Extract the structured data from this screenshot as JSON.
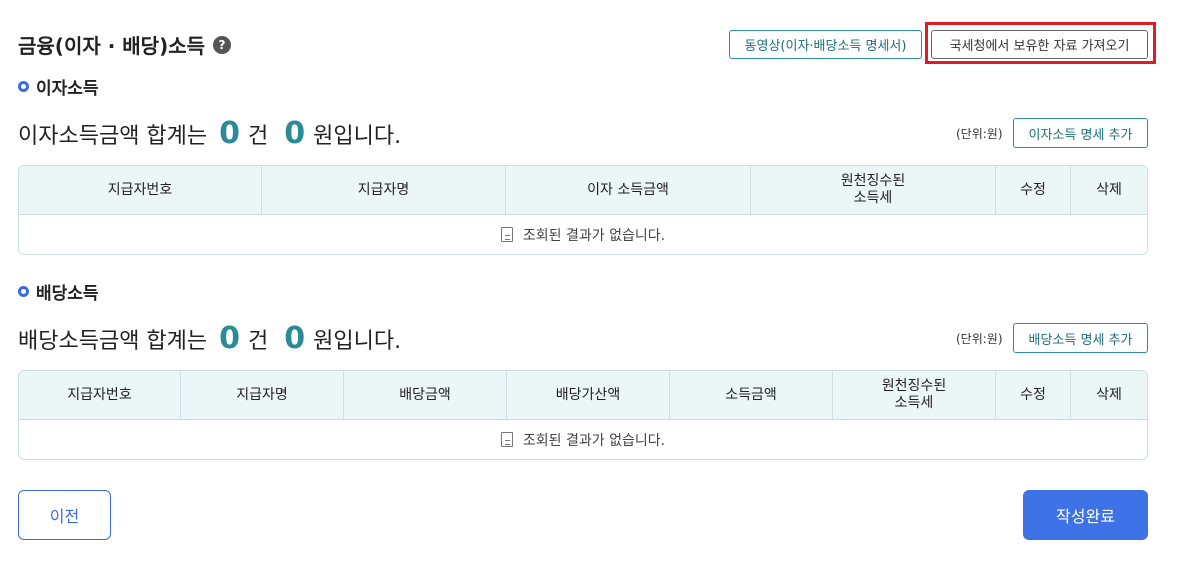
{
  "header": {
    "title": "금융(이자 · 배당)소득",
    "help_icon": "?",
    "video_button": "동영상(이자·배당소득 명세서)",
    "import_button": "국세청에서 보유한 자료 가져오기"
  },
  "interest": {
    "section_label": "이자소득",
    "summary_prefix": "이자소득금액 합계는",
    "count": "0",
    "count_unit": "건",
    "amount": "0",
    "amount_suffix": "원입니다.",
    "unit_note": "(단위:원)",
    "add_button": "이자소득 명세 추가",
    "columns": [
      "지급자번호",
      "지급자명",
      "이자 소득금액",
      "원천징수된\n소득세",
      "수정",
      "삭제"
    ],
    "empty_text": "조회된 결과가 없습니다."
  },
  "dividend": {
    "section_label": "배당소득",
    "summary_prefix": "배당소득금액 합계는",
    "count": "0",
    "count_unit": "건",
    "amount": "0",
    "amount_suffix": "원입니다.",
    "unit_note": "(단위:원)",
    "add_button": "배당소득 명세 추가",
    "columns": [
      "지급자번호",
      "지급자명",
      "배당금액",
      "배당가산액",
      "소득금액",
      "원천징수된\n소득세",
      "수정",
      "삭제"
    ],
    "empty_text": "조회된 결과가 없습니다."
  },
  "footer": {
    "prev_button": "이전",
    "done_button": "작성완료"
  },
  "colors": {
    "accent_teal": "#2a8a96",
    "primary_blue": "#3d73e6",
    "highlight_red": "#e01d26"
  }
}
